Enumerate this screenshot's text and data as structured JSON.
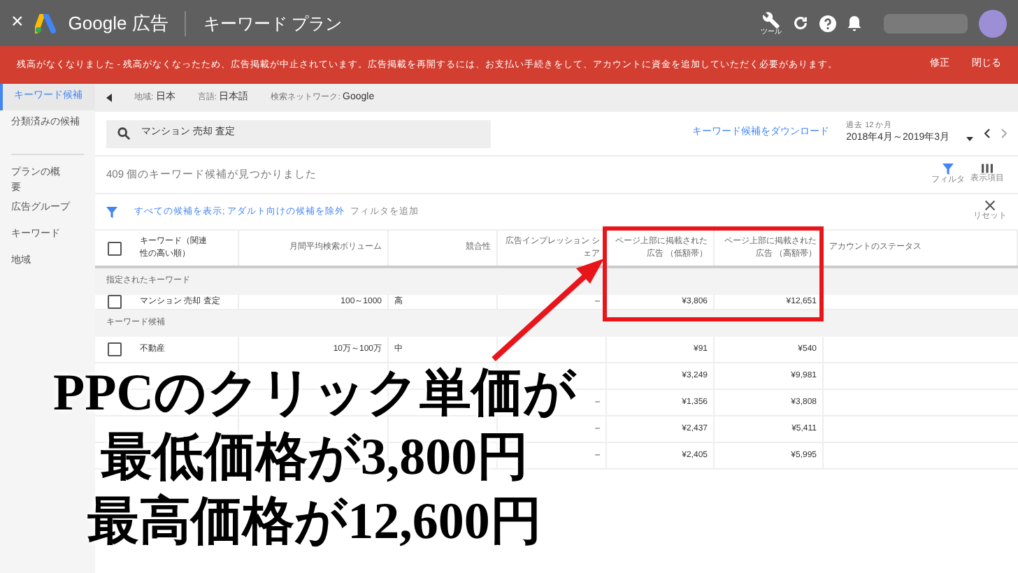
{
  "topbar": {
    "close": "×",
    "brand": "Google 広告",
    "page_title": "キーワード プラン",
    "tool_label": "ツール"
  },
  "alert": {
    "message": "残高がなくなりました - 残高がなくなったため、広告掲載が中止されています。広告掲載を再開するには、お支払い手続きをして、アカウントに資金を追加していただく必要があります。",
    "actions": [
      "修正",
      "閉じる"
    ]
  },
  "sidebar": {
    "items": [
      {
        "label": "キーワード候補",
        "selected": true
      },
      {
        "label": "分類済みの候補",
        "selected": false
      },
      {
        "label": "プランの概要",
        "selected": false
      },
      {
        "label": "広告グループ",
        "selected": false
      },
      {
        "label": "キーワード",
        "selected": false
      },
      {
        "label": "地域",
        "selected": false
      }
    ]
  },
  "settings_bar": [
    {
      "label": "地域:",
      "value": "日本"
    },
    {
      "label": "言語:",
      "value": "日本語"
    },
    {
      "label": "検索ネットワーク:",
      "value": "Google"
    }
  ],
  "search": {
    "value": "マンション 売却 査定"
  },
  "download_link": "キーワード候補をダウンロード",
  "date_range": {
    "label": "過去 12 か月",
    "value": "2018年4月～2019年3月"
  },
  "result_count": "409 個のキーワード候補が見つかりました",
  "tools": [
    {
      "label": "フィルタ"
    },
    {
      "label": "表示項目"
    }
  ],
  "filter_bar": {
    "active": "すべての候補を表示; アダルト向けの候補を除外",
    "add": "フィルタを追加",
    "reset": "リセット"
  },
  "table": {
    "select_all": {
      "checked": false
    },
    "columns": [
      "キーワード（関連性の高い順）",
      "月間平均検索ボリューム",
      "競合性",
      "広告インプレッション シェア",
      "ページ上部に掲載された広告 （低額帯）",
      "ページ上部に掲載された広告 （高額帯）",
      "アカウントのステータス"
    ],
    "sections": [
      {
        "title": "指定されたキーワード",
        "rows": [
          {
            "checked": false,
            "keyword": "マンション 売却 査定",
            "volume": "100～1000",
            "competition": "高",
            "share": "–",
            "low": "¥3,806",
            "high": "¥12,651"
          }
        ]
      },
      {
        "title": "キーワード候補",
        "rows": [
          {
            "checked": false,
            "keyword": "不動産",
            "volume": "10万～100万",
            "competition": "中",
            "share": "",
            "low": "¥91",
            "high": "¥540"
          },
          {
            "keyword": "",
            "volume": "",
            "competition": "",
            "share": "",
            "low": "¥3,249",
            "high": "¥9,981"
          },
          {
            "keyword": "",
            "volume": "",
            "competition": "",
            "share": "–",
            "low": "¥1,356",
            "high": "¥3,808"
          },
          {
            "keyword": "",
            "volume": "",
            "competition": "",
            "share": "–",
            "low": "¥2,437",
            "high": "¥5,411"
          },
          {
            "keyword": "",
            "volume": "",
            "competition": "",
            "share": "–",
            "low": "¥2,405",
            "high": "¥5,995"
          }
        ]
      }
    ]
  },
  "caption": [
    "PPCのクリック単価が",
    "最低価格が3,800円",
    "最高価格が12,600円"
  ]
}
